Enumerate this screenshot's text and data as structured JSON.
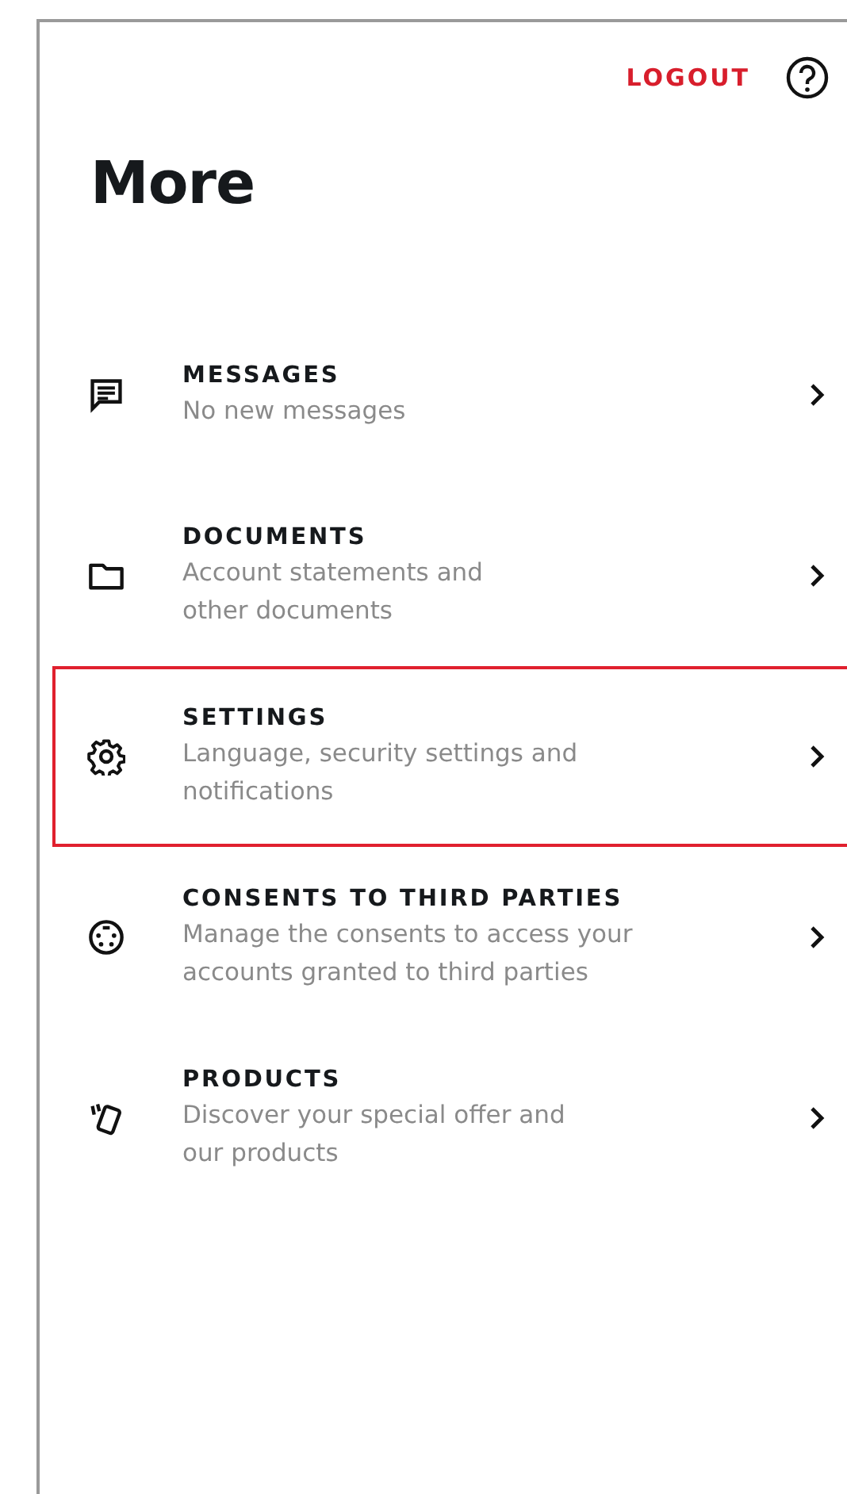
{
  "header": {
    "logout": "LOGOUT"
  },
  "title": "More",
  "items": [
    {
      "title": "MESSAGES",
      "subtitle_lines": [
        "No new messages"
      ],
      "highlighted": false
    },
    {
      "title": "DOCUMENTS",
      "subtitle_lines": [
        "Account statements and",
        "other documents"
      ],
      "highlighted": false
    },
    {
      "title": "SETTINGS",
      "subtitle_lines": [
        "Language, security settings and",
        "notifications"
      ],
      "highlighted": true
    },
    {
      "title": "CONSENTS TO THIRD PARTIES",
      "subtitle_lines": [
        "Manage the consents to access your",
        "accounts granted to third parties"
      ],
      "highlighted": false
    },
    {
      "title": "PRODUCTS",
      "subtitle_lines": [
        "Discover your special offer and",
        "our products"
      ],
      "highlighted": false
    }
  ]
}
